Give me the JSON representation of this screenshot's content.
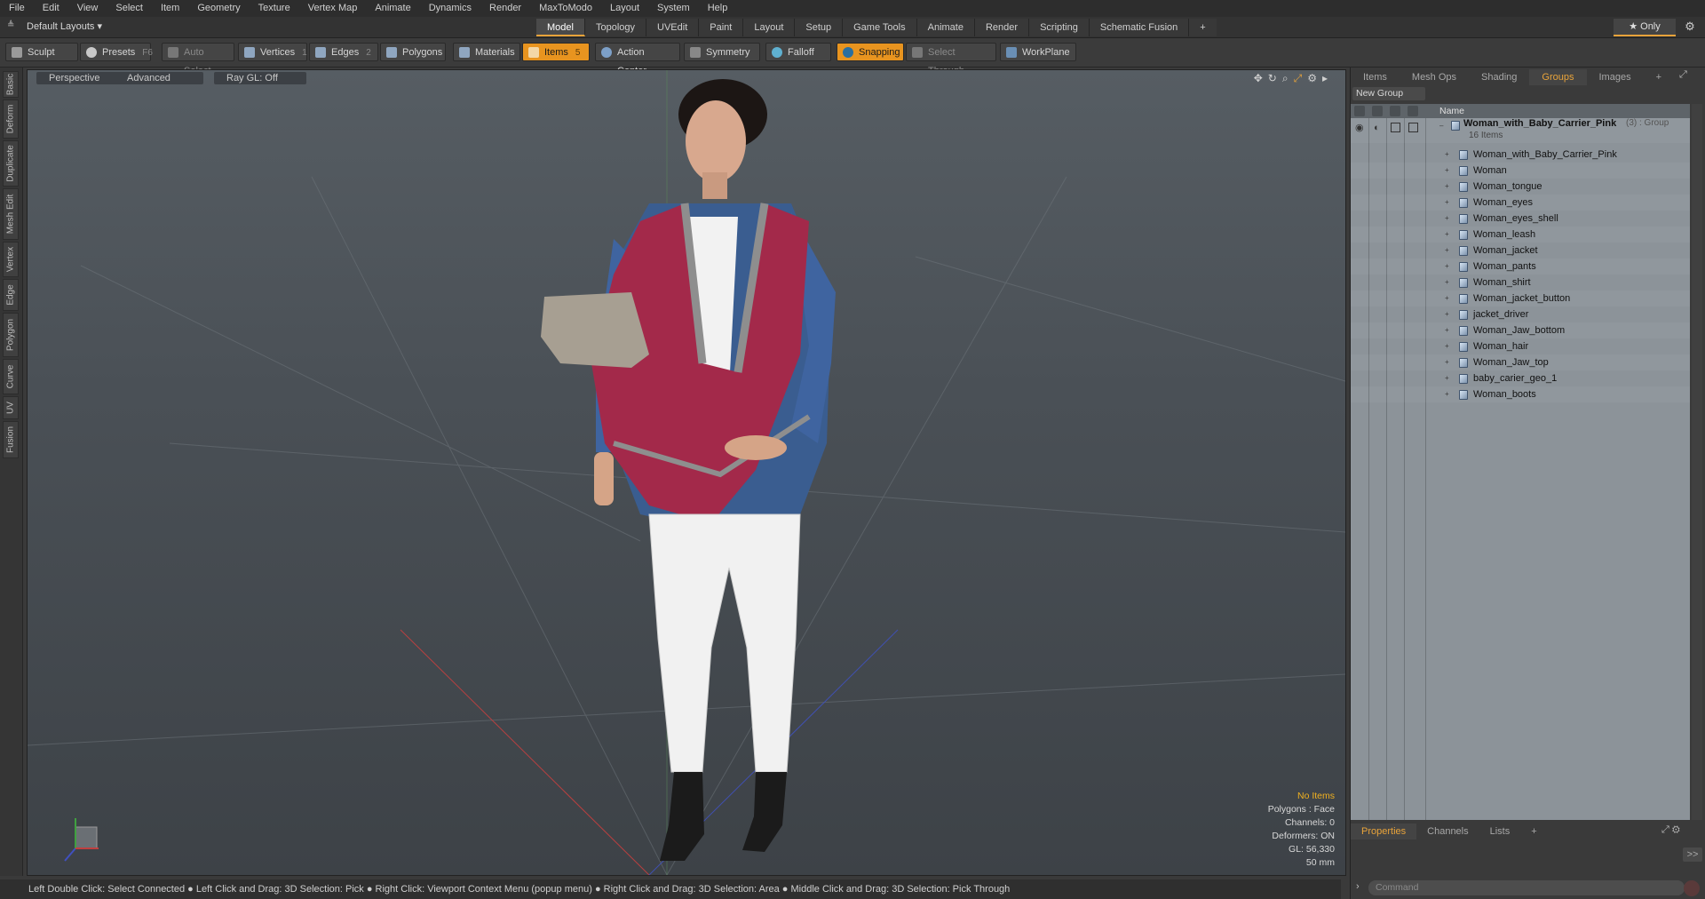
{
  "menu": [
    "File",
    "Edit",
    "View",
    "Select",
    "Item",
    "Geometry",
    "Texture",
    "Vertex Map",
    "Animate",
    "Dynamics",
    "Render",
    "MaxToModo",
    "Layout",
    "System",
    "Help"
  ],
  "layout_select": "Default Layouts ▾",
  "tabs": [
    "Model",
    "Topology",
    "UVEdit",
    "Paint",
    "Layout",
    "Setup",
    "Game Tools",
    "Animate",
    "Render",
    "Scripting",
    "Schematic Fusion"
  ],
  "tab_add": "+",
  "only_label": "★ Only",
  "toolbar": {
    "sculpt": "Sculpt",
    "presets": "Presets",
    "presets_key": "F6",
    "auto_select": "Auto Select",
    "vertices": "Vertices",
    "vertices_key": "1",
    "edges": "Edges",
    "edges_key": "2",
    "polygons": "Polygons",
    "materials": "Materials",
    "items": "Items",
    "items_key": "5",
    "action_center": "Action Center",
    "symmetry": "Symmetry",
    "falloff": "Falloff",
    "snapping": "Snapping",
    "select_through": "Select Through",
    "workplane": "WorkPlane"
  },
  "left_tabs": [
    "Basic",
    "Deform",
    "Duplicate",
    "Mesh Edit",
    "Vertex",
    "Edge",
    "Polygon",
    "Curve",
    "UV",
    "Fusion"
  ],
  "viewport": {
    "view": "Perspective",
    "shading": "Advanced",
    "raygl": "Ray GL: Off",
    "info": {
      "no_items": "No Items",
      "polygons": "Polygons : Face",
      "channels": "Channels: 0",
      "deformers": "Deformers: ON",
      "gl": "GL: 56,330",
      "scale": "50 mm"
    }
  },
  "status": "Left Double Click: Select Connected ● Left Click and Drag: 3D Selection: Pick ● Right Click: Viewport Context Menu (popup menu) ● Right Click and Drag: 3D Selection: Area ● Middle Click and Drag: 3D Selection: Pick Through",
  "right_panel": {
    "tabs": [
      "Items",
      "Mesh Ops",
      "Shading",
      "Groups",
      "Images"
    ],
    "tab_add": "+",
    "new_group": "New Group",
    "name_header": "Name",
    "group": {
      "name": "Woman_with_Baby_Carrier_Pink",
      "suffix": "(3) : Group",
      "count": "16 Items"
    },
    "items": [
      "Woman_with_Baby_Carrier_Pink",
      "Woman",
      "Woman_tongue",
      "Woman_eyes",
      "Woman_eyes_shell",
      "Woman_leash",
      "Woman_jacket",
      "Woman_pants",
      "Woman_shirt",
      "Woman_jacket_button",
      "jacket_driver",
      "Woman_Jaw_bottom",
      "Woman_hair",
      "Woman_Jaw_top",
      "baby_carier_geo_1",
      "Woman_boots"
    ],
    "bottom_tabs": [
      "Properties",
      "Channels",
      "Lists"
    ],
    "bottom_tab_add": "+",
    "expand": ">>",
    "command_placeholder": "Command"
  },
  "colors": {
    "accent": "#e8941f",
    "panel_bg": "#3a3a3a",
    "list_bg": "#8c9399"
  }
}
